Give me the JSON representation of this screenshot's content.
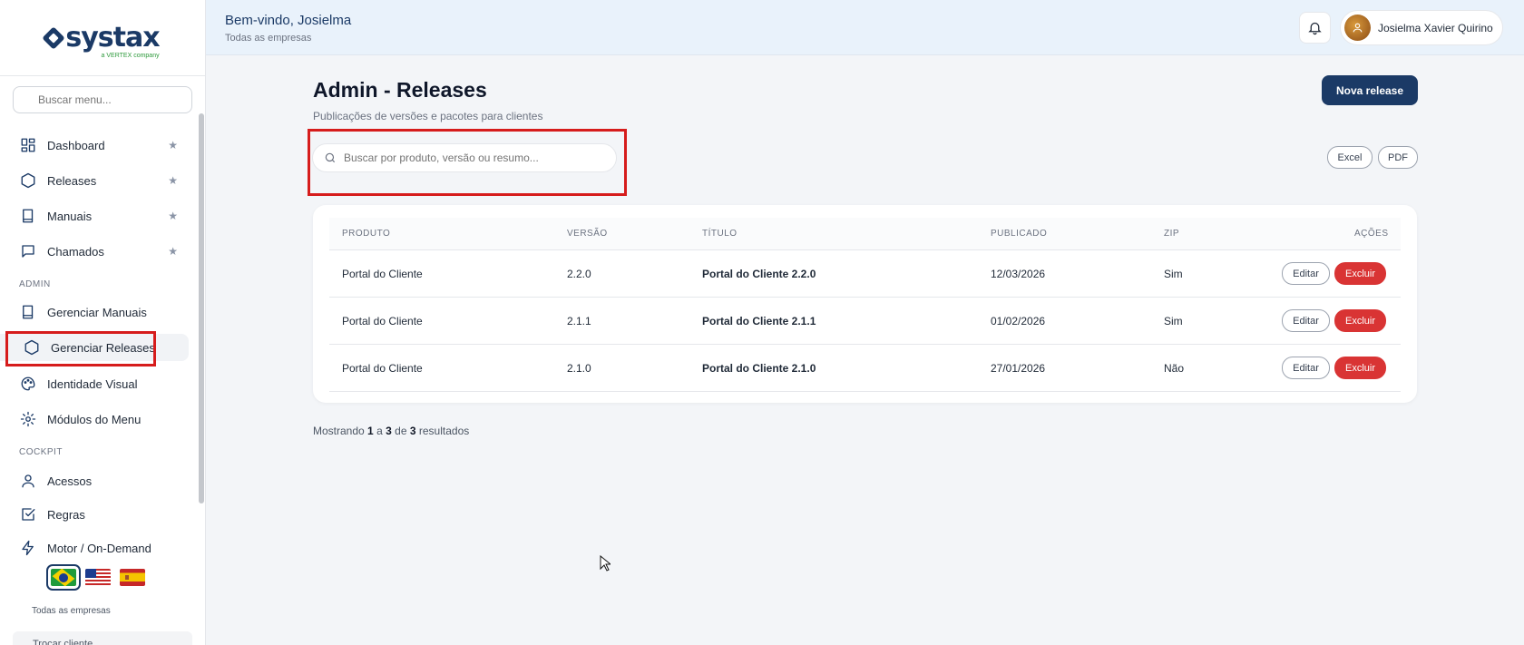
{
  "brand": {
    "name": "systax",
    "tagline": "a VERTEX company"
  },
  "sidebar": {
    "search_placeholder": "Buscar menu...",
    "items": [
      {
        "label": "Dashboard",
        "icon": "dashboard-icon",
        "starred": true
      },
      {
        "label": "Releases",
        "icon": "hexagon-icon",
        "starred": true
      },
      {
        "label": "Manuais",
        "icon": "book-icon",
        "starred": true
      },
      {
        "label": "Chamados",
        "icon": "chat-icon",
        "starred": true
      }
    ],
    "admin_section": "ADMIN",
    "admin_items": [
      {
        "label": "Gerenciar Manuais",
        "icon": "book-icon"
      },
      {
        "label": "Gerenciar Releases",
        "icon": "hexagon-icon",
        "active": true
      },
      {
        "label": "Identidade Visual",
        "icon": "palette-icon"
      },
      {
        "label": "Módulos do Menu",
        "icon": "gear-icon"
      }
    ],
    "cockpit_section": "COCKPIT",
    "cockpit_items": [
      {
        "label": "Acessos",
        "icon": "user-icon"
      },
      {
        "label": "Regras",
        "icon": "checkbox-icon"
      },
      {
        "label": "Motor / On-Demand",
        "icon": "bolt-icon"
      }
    ],
    "languages": [
      "pt-BR",
      "en-US",
      "es-ES"
    ],
    "selected_language": "pt-BR",
    "company_label": "Todas as empresas",
    "switch_client": "Trocar cliente"
  },
  "header": {
    "welcome": "Bem-vindo, Josielma",
    "company": "Todas as empresas",
    "user_name": "Josielma Xavier Quirino"
  },
  "main": {
    "title": "Admin - Releases",
    "subtitle": "Publicações de versões e pacotes para clientes",
    "new_button": "Nova release",
    "search_placeholder": "Buscar por produto, versão ou resumo...",
    "export_excel": "Excel",
    "export_pdf": "PDF",
    "columns": [
      "PRODUTO",
      "VERSÃO",
      "TÍTULO",
      "PUBLICADO",
      "ZIP",
      "AÇÕES"
    ],
    "rows": [
      {
        "produto": "Portal do Cliente",
        "versao": "2.2.0",
        "titulo": "Portal do Cliente 2.2.0",
        "publicado": "12/03/2026",
        "zip": "Sim"
      },
      {
        "produto": "Portal do Cliente",
        "versao": "2.1.1",
        "titulo": "Portal do Cliente 2.1.1",
        "publicado": "01/02/2026",
        "zip": "Sim"
      },
      {
        "produto": "Portal do Cliente",
        "versao": "2.1.0",
        "titulo": "Portal do Cliente 2.1.0",
        "publicado": "27/01/2026",
        "zip": "Não"
      }
    ],
    "edit_label": "Editar",
    "delete_label": "Excluir",
    "pagination": {
      "prefix": "Mostrando",
      "from": "1",
      "a": "a",
      "to": "3",
      "de": "de",
      "total": "3",
      "suffix": "resultados"
    }
  },
  "colors": {
    "primary": "#1b3a66",
    "danger": "#d93434",
    "highlight": "#d61c1c"
  }
}
